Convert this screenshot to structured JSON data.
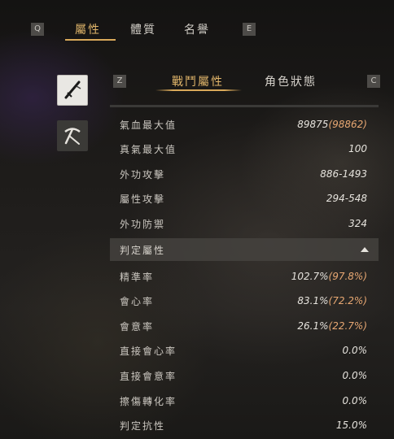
{
  "top_tabs": {
    "left_key": "Q",
    "right_key": "E",
    "items": [
      {
        "label": "屬性"
      },
      {
        "label": "體質"
      },
      {
        "label": "名譽"
      }
    ]
  },
  "sidebar": {
    "items": [
      {
        "icon": "sword-icon"
      },
      {
        "icon": "pickaxe-icon"
      }
    ]
  },
  "panel": {
    "left_key": "Z",
    "right_key": "C",
    "tabs": [
      {
        "label": "戰鬥屬性"
      },
      {
        "label": "角色狀態"
      }
    ],
    "stats": [
      {
        "label": "氣血最大值",
        "value": "89875",
        "bonus": "(98862)"
      },
      {
        "label": "真氣最大值",
        "value": "100",
        "bonus": ""
      },
      {
        "label": "外功攻擊",
        "value": "886-1493",
        "bonus": ""
      },
      {
        "label": "屬性攻擊",
        "value": "294-548",
        "bonus": ""
      },
      {
        "label": "外功防禦",
        "value": "324",
        "bonus": ""
      }
    ],
    "section": {
      "label": "判定屬性"
    },
    "judge_stats": [
      {
        "label": "精準率",
        "value": "102.7%",
        "bonus": "(97.8%)"
      },
      {
        "label": "會心率",
        "value": "83.1%",
        "bonus": "(72.2%)"
      },
      {
        "label": "會意率",
        "value": "26.1%",
        "bonus": "(22.7%)"
      },
      {
        "label": "直接會心率",
        "value": "",
        "bonus": "0.0%"
      },
      {
        "label": "直接會意率",
        "value": "",
        "bonus": "0.0%"
      },
      {
        "label": "擦傷轉化率",
        "value": "0.0%",
        "bonus": ""
      },
      {
        "label": "判定抗性",
        "value": "15.0%",
        "bonus": ""
      }
    ]
  },
  "colors": {
    "accent": "#e0b56a",
    "bonus": "#e7a772"
  }
}
